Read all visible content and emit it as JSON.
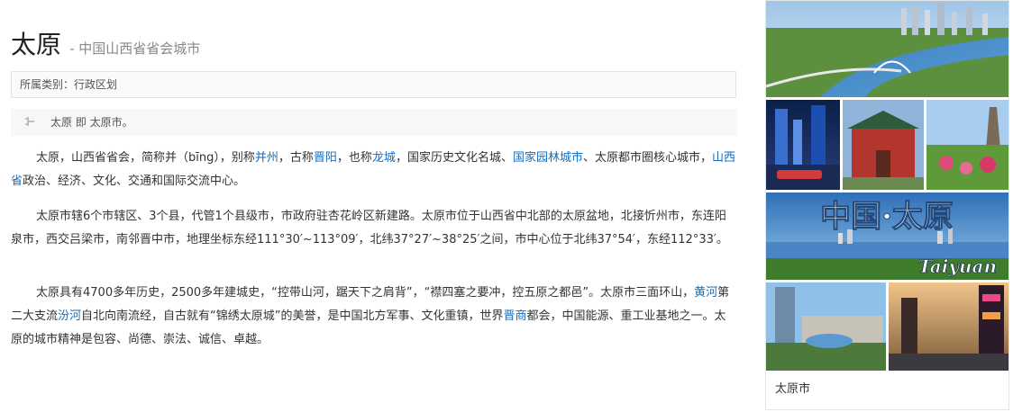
{
  "header": {
    "title": "太原",
    "subtitle": "- 中国山西省省会城市"
  },
  "category": {
    "text": "所属类别：行政区划"
  },
  "redirect": {
    "text": "太原 即 太原市。",
    "icon": "redirect-icon"
  },
  "paragraphs": {
    "p1": {
      "t1": "太原，山西省省会，简称并（bīng），别称",
      "l1": "并州",
      "t2": "，古称",
      "l2": "晋阳",
      "t3": "，也称",
      "l3": "龙城",
      "t4": "，国家历史文化名城、",
      "l4": "国家园林城市",
      "t5": "、太原都市圈核心城市，",
      "l5": "山西省",
      "t6": "政治、经济、文化、交通和国际交流中心。"
    },
    "p2": {
      "text": "太原市辖6个市辖区、3个县，代管1个县级市，市政府驻杏花岭区新建路。太原市位于山西省中北部的太原盆地，北接忻州市，东连阳泉市，西交吕梁市，南邻晋中市，地理坐标东经111°30′~113°09′，北纬37°27′~38°25′之间，市中心位于北纬37°54′，东经112°33′。"
    },
    "p3": {
      "t1": "太原具有4700多年历史，2500多年建城史，“控带山河，踞天下之肩背”，“襟四塞之要冲，控五原之都邑”。太原市三面环山，",
      "l1": "黄河",
      "t2": "第二大支流",
      "l2": "汾河",
      "t3": "自北向南流经，自古就有“锦绣太原城”的美誉，是中国北方军事、文化重镇，世界",
      "l3": "晋商",
      "t4": "都会，中国能源、重工业基地之一。太原的城市精神是包容、尚德、崇法、诚信、卓越。"
    }
  },
  "sidebar": {
    "banner_cn": "中国·太原",
    "banner_en": "Taiyuan",
    "caption": "太原市"
  },
  "colors": {
    "link": "#136ec2",
    "border": "#e3e3e3"
  }
}
